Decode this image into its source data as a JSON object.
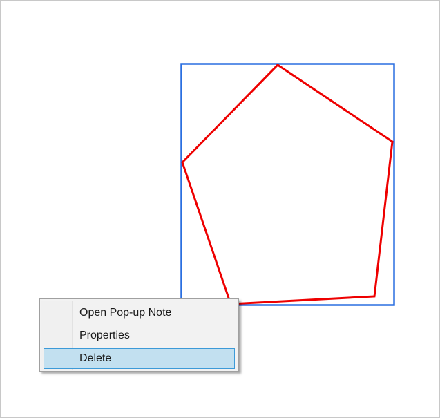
{
  "annotation": {
    "type": "polygon",
    "stroke_color": "#ee0000",
    "selection_color": "#2a6fe0"
  },
  "context_menu": {
    "items": [
      {
        "label": "Open Pop-up Note",
        "highlighted": false
      },
      {
        "label": "Properties",
        "highlighted": false
      },
      {
        "label": "Delete",
        "highlighted": true
      }
    ],
    "highlight_color": "#c2e0f0",
    "highlight_border": "#3c9ad8"
  }
}
